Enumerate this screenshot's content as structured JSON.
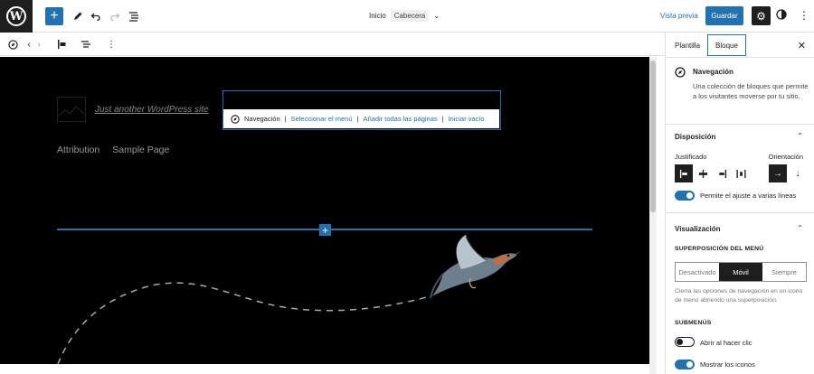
{
  "topbar": {
    "breadcrumb_parent": "Inicio",
    "breadcrumb_current": "Cabecera",
    "preview_label": "Vista previa",
    "save_label": "Guardar"
  },
  "canvas": {
    "tagline": "Just another WordPress site",
    "nav_placeholder": {
      "block_name": "Navegación",
      "select_menu": "Seleccionar el menú",
      "add_all_pages": "Añadir todas las páginas",
      "start_empty": "Iniciar vacío"
    },
    "menu_items": [
      "Attribution",
      "Sample Page"
    ]
  },
  "sidebar": {
    "tabs": [
      "Plantilla",
      "Bloque"
    ],
    "active_tab": "Bloque",
    "block": {
      "title": "Navegación",
      "description": "Una colección de bloques que permite a los visitantes moverse por tu sitio."
    },
    "layout": {
      "title": "Disposición",
      "justify_label": "Justificado",
      "orientation_label": "Orientación",
      "wrap_label": "Permite el ajuste a varias líneas",
      "wrap_on": true
    },
    "display": {
      "title": "Visualización",
      "overlay_label": "SUPERPOSICIÓN DEL MENÚ",
      "overlay_options": [
        "Desactivado",
        "Móvil",
        "Siempre"
      ],
      "overlay_selected": "Móvil",
      "overlay_help": "Cierra las opciones de navegación en un icono de menú abriendo una superposición.",
      "submenus_label": "SUBMENÚS",
      "open_on_click_label": "Abrir al hacer clic",
      "open_on_click_on": false,
      "show_icons_label": "Mostrar los iconos",
      "show_icons_on": true
    }
  },
  "colors": {
    "accent": "#2271b1",
    "dark": "#1e1e1e",
    "canvas_bg": "#000000"
  }
}
